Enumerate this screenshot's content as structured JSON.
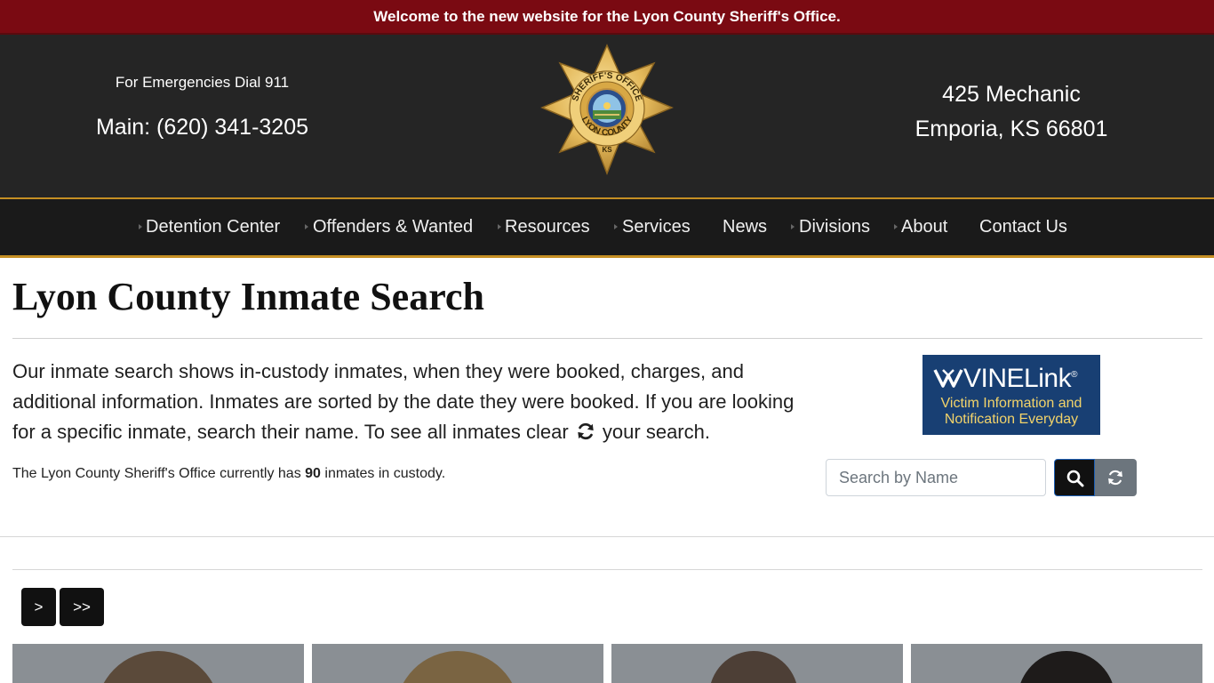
{
  "announcement": "Welcome to the new website for the Lyon County Sheriff's Office.",
  "header": {
    "emergency": "For Emergencies Dial 911",
    "main_phone": "Main: (620) 341-3205",
    "address_line1": "425 Mechanic",
    "address_line2": "Emporia, KS 66801",
    "badge": {
      "top_arc": "SHERIFF'S OFFICE",
      "bottom_arc": "LYON COUNTY",
      "state": "KS",
      "seal_text": "STATE OF KANSAS"
    }
  },
  "nav": {
    "items": [
      {
        "label": "Detention Center"
      },
      {
        "label": "Offenders & Wanted"
      },
      {
        "label": "Resources"
      },
      {
        "label": "Services"
      },
      {
        "label": "News"
      },
      {
        "label": "Divisions"
      },
      {
        "label": "About"
      },
      {
        "label": "Contact Us"
      }
    ]
  },
  "page": {
    "title": "Lyon County Inmate Search",
    "intro_before_icon": "Our inmate search shows in-custody inmates, when they were booked, charges, and additional information. Inmates are sorted by the date they were booked. If you are looking for a specific inmate, search their name. To see all inmates clear",
    "intro_after_icon": "your search.",
    "count_prefix": "The Lyon County Sheriff's Office currently has",
    "count_value": "90",
    "count_suffix": "inmates in custody."
  },
  "vinelink": {
    "brand_a": "VINE",
    "brand_b": "Link",
    "registered": "®",
    "tagline_1": "Victim Information and",
    "tagline_2": "Notification Everyday"
  },
  "search": {
    "placeholder": "Search by Name",
    "value": ""
  },
  "pagination": {
    "next_label": ">",
    "last_label": ">>"
  },
  "colors": {
    "announcement_bg": "#7a0a12",
    "header_bg": "#252525",
    "nav_bg": "#1a1a1a",
    "accent_gold": "#c58f24",
    "vine_bg": "#183f73",
    "vine_tagline": "#f2d36a"
  },
  "icons": {
    "search_button": "search-icon",
    "reset_button": "refresh-icon",
    "intro_inline": "refresh-icon"
  }
}
